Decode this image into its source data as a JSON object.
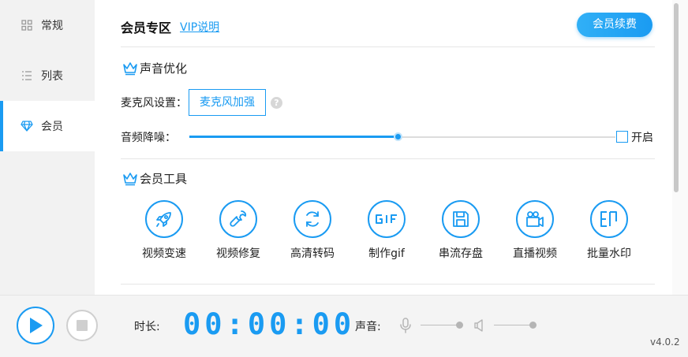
{
  "sidebar": {
    "items": [
      {
        "label": "常规",
        "icon": "grid-icon",
        "active": false
      },
      {
        "label": "列表",
        "icon": "list-icon",
        "active": false
      },
      {
        "label": "会员",
        "icon": "diamond-icon",
        "active": true
      }
    ]
  },
  "header": {
    "title": "会员专区",
    "vip_link": "VIP说明",
    "renew_button": "会员续费"
  },
  "sound": {
    "section_title": "声音优化",
    "mic_label": "麦克风设置：",
    "mic_value": "麦克风加强",
    "help": "?",
    "noise_label": "音频降噪：",
    "noise_level": 0.49,
    "enable_label": "开启",
    "enable_checked": false
  },
  "tools": {
    "section_title": "会员工具",
    "items": [
      {
        "label": "视频变速",
        "icon": "rocket-icon"
      },
      {
        "label": "视频修复",
        "icon": "wrench-icon"
      },
      {
        "label": "高清转码",
        "icon": "refresh-icon"
      },
      {
        "label": "制作gif",
        "icon": "gif-icon"
      },
      {
        "label": "串流存盘",
        "icon": "save-icon"
      },
      {
        "label": "直播视频",
        "icon": "camera-icon"
      },
      {
        "label": "批量水印",
        "icon": "watermark-icon"
      }
    ]
  },
  "player": {
    "duration_label": "时长:",
    "time": "00:00:00",
    "volume_label": "声音:",
    "mic_volume": 0.95,
    "speaker_volume": 0.95,
    "version": "v4.0.2"
  },
  "colors": {
    "accent": "#1a9bf2",
    "sidebar_bg": "#f2f2f2",
    "bottom_bg": "#f4f4f4"
  }
}
